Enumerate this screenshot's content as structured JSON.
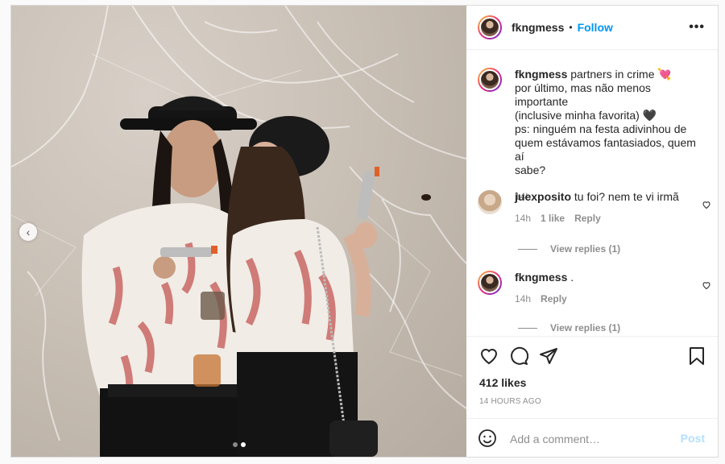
{
  "post": {
    "username": "fkngmess",
    "separator": "•",
    "follow_label": "Follow",
    "more_icon": "more-horizontal-icon",
    "caption_lines": [
      "partners in crime 💘",
      "por último, mas não menos importante",
      "(inclusive minha favorita) 🖤",
      "ps: ninguém na festa adivinhou de",
      "quem estávamos fantasiados, quem aí",
      "sabe?"
    ],
    "caption_time": "14h",
    "likes": "412 likes",
    "time_ago": "14 HOURS AGO"
  },
  "comments": [
    {
      "username": "juexposito",
      "text": "tu foi? nem te vi irmã",
      "time": "14h",
      "likes": "1 like",
      "reply": "Reply",
      "view_replies": "View replies (1)"
    },
    {
      "username": "fkngmess",
      "text": ".",
      "time": "14h",
      "reply": "Reply",
      "view_replies": "View replies (1)"
    }
  ],
  "add_comment": {
    "placeholder": "Add a comment…",
    "post_label": "Post"
  },
  "colors": {
    "accent": "#0095f6",
    "post_disabled": "#b2dffc",
    "muted": "#8e8e8e"
  },
  "icons": [
    "heart-icon",
    "comment-icon",
    "share-icon",
    "bookmark-icon",
    "emoji-icon",
    "chevron-left-icon"
  ]
}
